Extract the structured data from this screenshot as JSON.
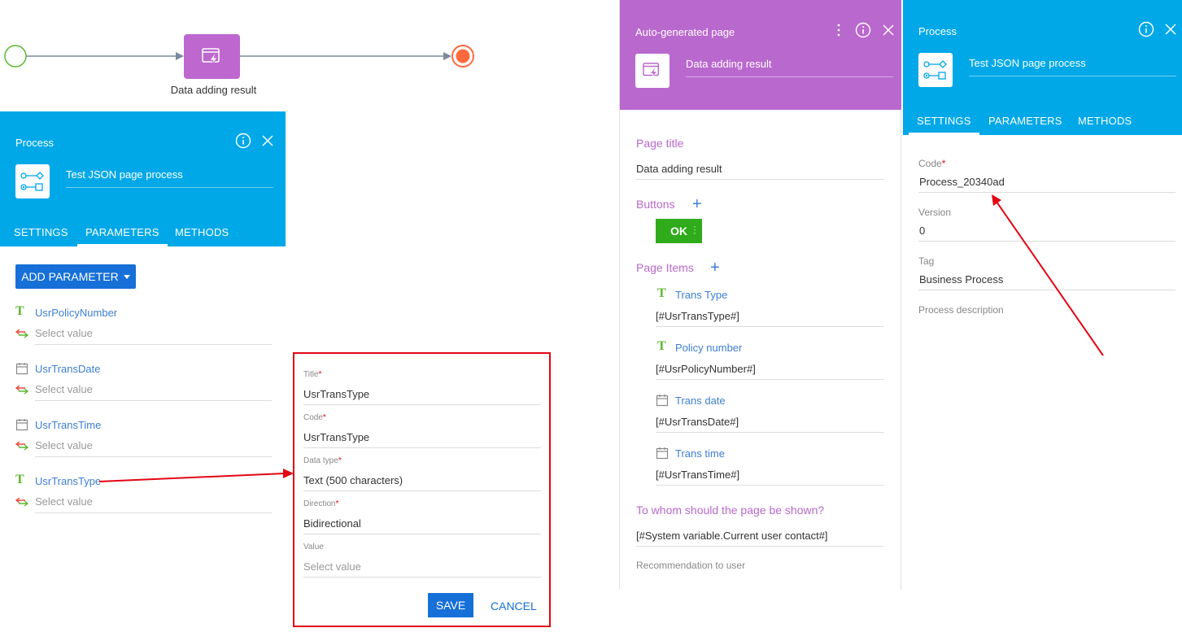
{
  "diagram": {
    "task_label": "Data adding result"
  },
  "left_process": {
    "panel_title": "Process",
    "process_name": "Test JSON page process",
    "tabs": [
      "SETTINGS",
      "PARAMETERS",
      "METHODS"
    ],
    "active_tab": "PARAMETERS"
  },
  "parameters": {
    "add_button_label": "ADD PARAMETER",
    "items": [
      {
        "name": "UsrPolicyNumber",
        "type_icon": "text-type-icon",
        "value": "Select value"
      },
      {
        "name": "UsrTransDate",
        "type_icon": "calendar-icon",
        "value": "Select value"
      },
      {
        "name": "UsrTransTime",
        "type_icon": "calendar-icon",
        "value": "Select value"
      },
      {
        "name": "UsrTransType",
        "type_icon": "text-type-icon",
        "value": "Select value"
      }
    ]
  },
  "edit_form": {
    "title_label": "Title",
    "title_value": "UsrTransType",
    "code_label": "Code",
    "code_value": "UsrTransType",
    "datatype_label": "Data type",
    "datatype_value": "Text (500 characters)",
    "direction_label": "Direction",
    "direction_value": "Bidirectional",
    "value_label": "Value",
    "value_placeholder": "Select value",
    "required_mark": "*",
    "save_label": "SAVE",
    "cancel_label": "CANCEL"
  },
  "auto_page": {
    "panel_title": "Auto-generated page",
    "element_name": "Data adding result",
    "page_title_label": "Page title",
    "page_title_value": "Data adding result",
    "buttons_label": "Buttons",
    "ok_label": "OK",
    "page_items_label": "Page Items",
    "items": [
      {
        "label": "Trans Type",
        "icon": "text-type-icon",
        "value": "[#UsrTransType#]"
      },
      {
        "label": "Policy number",
        "icon": "text-type-icon",
        "value": "[#UsrPolicyNumber#]"
      },
      {
        "label": "Trans date",
        "icon": "calendar-icon",
        "value": "[#UsrTransDate#]"
      },
      {
        "label": "Trans time",
        "icon": "calendar-icon",
        "value": "[#UsrTransTime#]"
      }
    ],
    "recipient_label": "To whom should the page be shown?",
    "recipient_value": "[#System variable.Current user contact#]",
    "recommendation_label": "Recommendation to user"
  },
  "right_process": {
    "panel_title": "Process",
    "process_name": "Test JSON page process",
    "tabs": [
      "SETTINGS",
      "PARAMETERS",
      "METHODS"
    ],
    "active_tab": "SETTINGS",
    "code_label": "Code",
    "code_value": "Process_20340ad",
    "version_label": "Version",
    "version_value": "0",
    "tag_label": "Tag",
    "tag_value": "Business Process",
    "description_label": "Process description"
  },
  "colors": {
    "process_blue": "#00a8e8",
    "page_purple": "#b968ce",
    "button_blue": "#1670d8",
    "ok_green": "#2fab1c",
    "annotation_red": "#e30613",
    "link_blue": "#3d7fd1"
  }
}
